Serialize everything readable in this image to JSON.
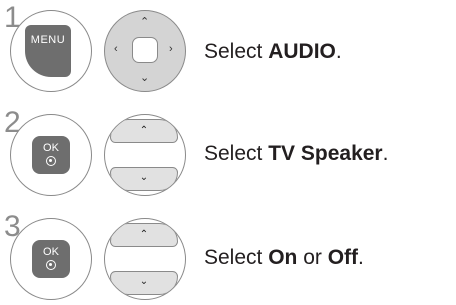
{
  "steps": [
    {
      "number": "1",
      "key_label": "MENU",
      "nav_icon": "four-way-dpad-icon",
      "text_prefix": "Select ",
      "text_bold": "AUDIO",
      "text_suffix": "."
    },
    {
      "number": "2",
      "key_label": "OK",
      "nav_icon": "up-down-arrows-icon",
      "text_prefix": "Select ",
      "text_bold": "TV Speaker",
      "text_suffix": "."
    },
    {
      "number": "3",
      "key_label": "OK",
      "nav_icon": "up-down-arrows-icon",
      "text_prefix": "Select ",
      "text_bold": "On",
      "text_mid": " or ",
      "text_bold2": "Off",
      "text_suffix": "."
    }
  ],
  "colors": {
    "key_fill": "#6e6e6e",
    "outline": "#8a8a8a",
    "number": "#8c8c8c",
    "text": "#231f20"
  }
}
